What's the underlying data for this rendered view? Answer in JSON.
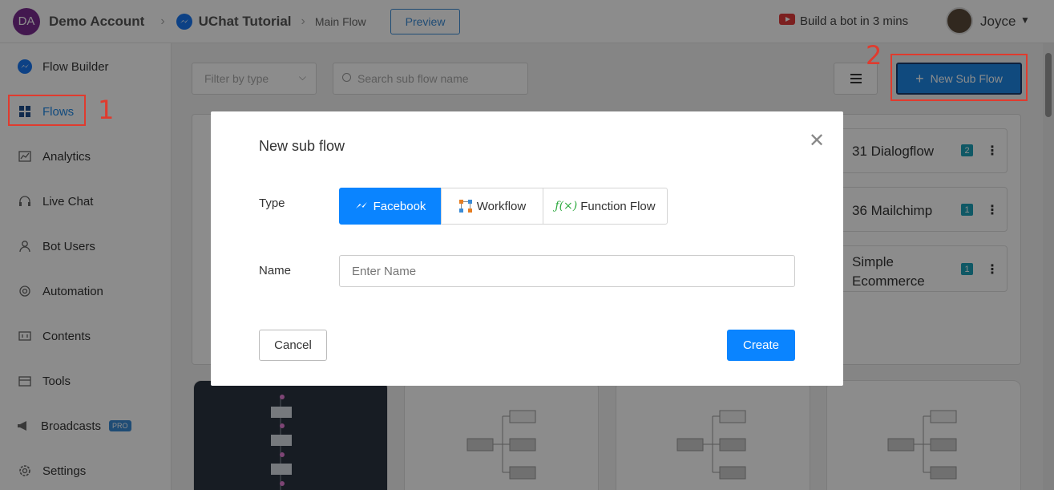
{
  "header": {
    "account_initials": "DA",
    "account_name": "Demo Account",
    "bot_name": "UChat Tutorial",
    "flow_name": "Main Flow",
    "preview_label": "Preview",
    "build_bot_label": "Build a bot in 3 mins",
    "user_name": "Joyce"
  },
  "sidebar": {
    "items": [
      {
        "label": "Flow Builder",
        "icon": "messenger-icon"
      },
      {
        "label": "Flows",
        "icon": "grid-icon"
      },
      {
        "label": "Analytics",
        "icon": "chart-icon"
      },
      {
        "label": "Live Chat",
        "icon": "headset-icon"
      },
      {
        "label": "Bot Users",
        "icon": "user-icon"
      },
      {
        "label": "Automation",
        "icon": "gear-icon"
      },
      {
        "label": "Contents",
        "icon": "content-icon"
      },
      {
        "label": "Tools",
        "icon": "toolbox-icon"
      },
      {
        "label": "Broadcasts",
        "icon": "megaphone-icon"
      },
      {
        "label": "Settings",
        "icon": "settings-icon"
      }
    ],
    "pro_badge": "PRO"
  },
  "toolbar": {
    "filter_placeholder": "Filter by type",
    "search_placeholder": "Search sub flow name",
    "new_sub_flow_label": "New Sub Flow"
  },
  "annotations": {
    "step1": "1",
    "step2": "2"
  },
  "subflows": [
    {
      "title": "31 Dialogflow",
      "badge": "2"
    },
    {
      "title": "36 Mailchimp",
      "badge": "1"
    },
    {
      "title": "Simple Ecommerce",
      "badge": "1"
    }
  ],
  "modal": {
    "title": "New sub flow",
    "type_label": "Type",
    "types": [
      "Facebook",
      "Workflow",
      "Function Flow"
    ],
    "selected_type": "Facebook",
    "name_label": "Name",
    "name_placeholder": "Enter Name",
    "cancel_label": "Cancel",
    "create_label": "Create"
  },
  "colors": {
    "primary": "#0a84ff",
    "annotation_red": "#e03b2e",
    "messenger_blue": "#1877f2"
  }
}
